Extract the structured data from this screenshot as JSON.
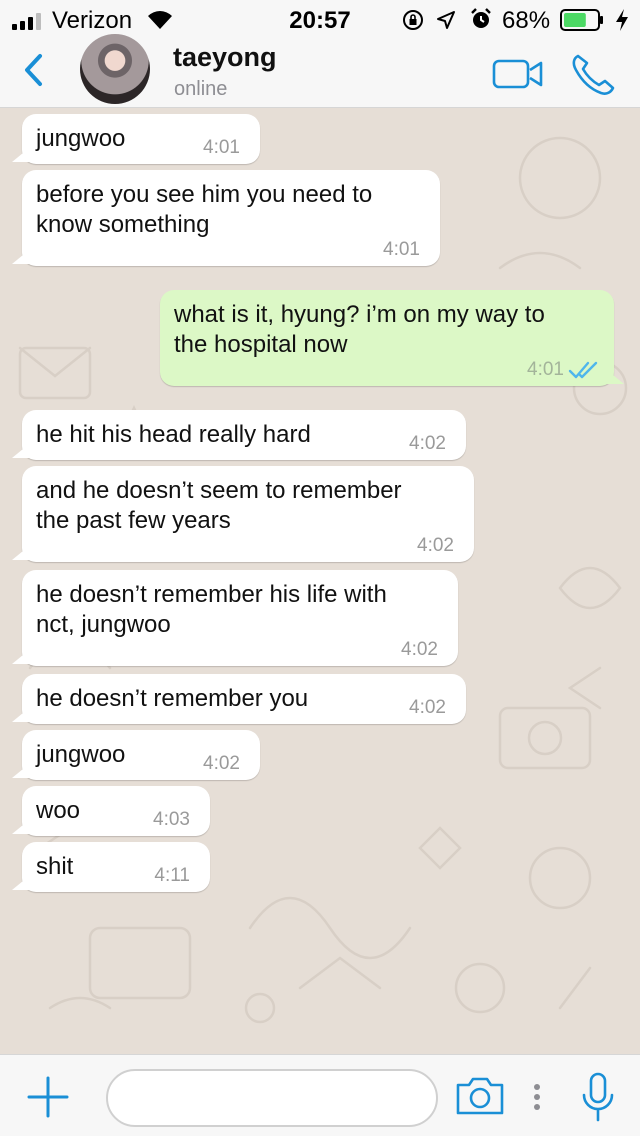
{
  "status_bar": {
    "carrier": "Verizon",
    "time": "20:57",
    "battery_percent": "68%",
    "battery_level": 0.68,
    "icons": [
      "signal-icon",
      "wifi-icon",
      "rotation-lock-icon",
      "location-icon",
      "alarm-icon",
      "battery-icon",
      "charging-bolt-icon"
    ]
  },
  "header": {
    "contact_name": "taeyong",
    "contact_status": "online",
    "icons": [
      "back-chevron-icon",
      "avatar",
      "video-call-icon",
      "phone-icon"
    ],
    "accent_color": "#1a8fd6"
  },
  "messages": [
    {
      "direction": "in",
      "text": "jungwoo",
      "time": "4:01"
    },
    {
      "direction": "in",
      "text": "before you see him you need to\nknow something",
      "time": "4:01"
    },
    {
      "direction": "out",
      "text": "what is it, hyung? i’m on my way to\nthe hospital now",
      "time": "4:01",
      "status": "read"
    },
    {
      "direction": "in",
      "text": "he hit his head really hard",
      "time": "4:02"
    },
    {
      "direction": "in",
      "text": "and he doesn’t seem to remember\nthe past few years",
      "time": "4:02"
    },
    {
      "direction": "in",
      "text": "he doesn’t remember his life with\nnct, jungwoo",
      "time": "4:02"
    },
    {
      "direction": "in",
      "text": "he doesn’t remember you",
      "time": "4:02"
    },
    {
      "direction": "in",
      "text": "jungwoo",
      "time": "4:02"
    },
    {
      "direction": "in",
      "text": "woo",
      "time": "4:03"
    },
    {
      "direction": "in",
      "text": "shit",
      "time": "4:11"
    }
  ],
  "input_bar": {
    "placeholder": "",
    "icons": [
      "plus-icon",
      "camera-icon",
      "more-dots-icon",
      "microphone-icon"
    ]
  },
  "colors": {
    "incoming_bubble": "#ffffff",
    "outgoing_bubble": "#dcf8c6",
    "read_ticks": "#4fb6ec",
    "chat_background": "#e6ded6"
  }
}
